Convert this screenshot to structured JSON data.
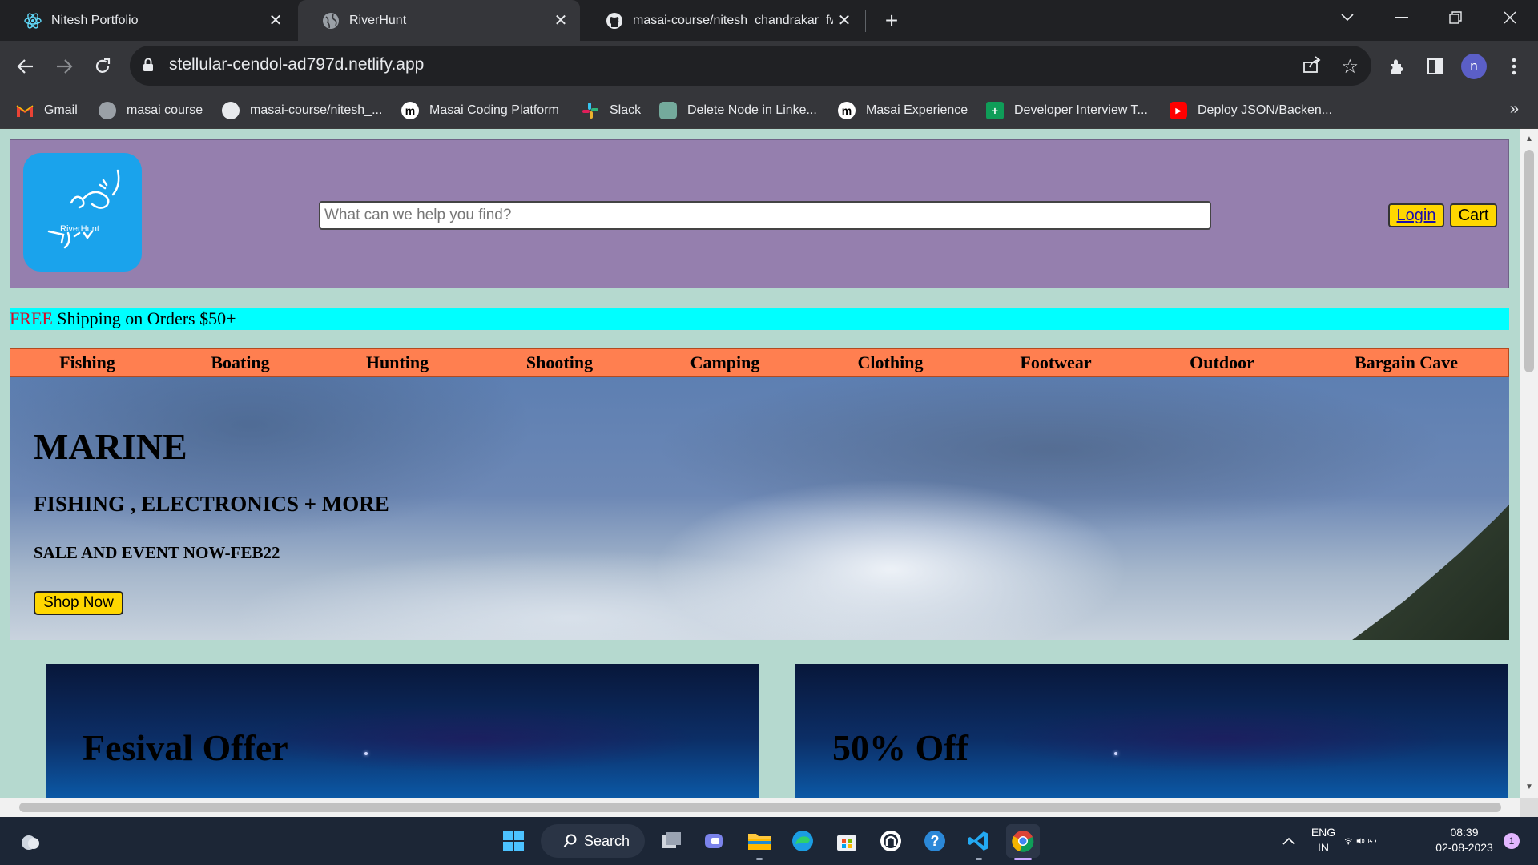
{
  "browser": {
    "tabs": [
      {
        "title": "Nitesh Portfolio",
        "active": false
      },
      {
        "title": "RiverHunt",
        "active": true
      },
      {
        "title": "masai-course/nitesh_chandrakar_fw...",
        "active": false
      }
    ],
    "url": "stellular-cendol-ad797d.netlify.app",
    "profile_initial": "n",
    "bookmarks": [
      {
        "label": "Gmail",
        "icon": "gmail-icon"
      },
      {
        "label": "masai course",
        "icon": "globe-icon"
      },
      {
        "label": "masai-course/nitesh_...",
        "icon": "github-icon"
      },
      {
        "label": "Masai Coding Platform",
        "icon": "masai-icon"
      },
      {
        "label": "Slack",
        "icon": "slack-icon"
      },
      {
        "label": "Delete Node in Linke...",
        "icon": "chatgpt-icon"
      },
      {
        "label": "Masai Experience",
        "icon": "masai-icon"
      },
      {
        "label": "Developer Interview T...",
        "icon": "sheets-icon"
      },
      {
        "label": "Deploy JSON/Backen...",
        "icon": "youtube-icon"
      }
    ],
    "bookmarks_more": "»"
  },
  "page": {
    "logo_text": "RiverHunt",
    "search_placeholder": "What can we help you find?",
    "login_label": "Login",
    "cart_label": "Cart",
    "promo": {
      "free": "FREE",
      "rest": " Shipping on Orders $50+"
    },
    "categories": [
      "Fishing",
      "Boating",
      "Hunting",
      "Shooting",
      "Camping",
      "Clothing",
      "Footwear",
      "Outdoor",
      "Bargain Cave"
    ],
    "hero": {
      "title": "MARINE",
      "subtitle": "FISHING , ELECTRONICS + MORE",
      "sale": "SALE AND EVENT NOW-FEB22",
      "cta": "Shop Now"
    },
    "cards": [
      {
        "title": "Fesival Offer"
      },
      {
        "title": "50% Off"
      }
    ]
  },
  "taskbar": {
    "search_label": "Search",
    "lang_line1": "ENG",
    "lang_line2": "IN",
    "time": "08:39",
    "date": "02-08-2023",
    "notification_count": "1"
  },
  "colors": {
    "header_bg": "#957fae",
    "promo_bg": "#00ffff",
    "nav_bg": "#ff7f50",
    "button_bg": "#ffd700",
    "page_bg": "#b5d9cf"
  }
}
